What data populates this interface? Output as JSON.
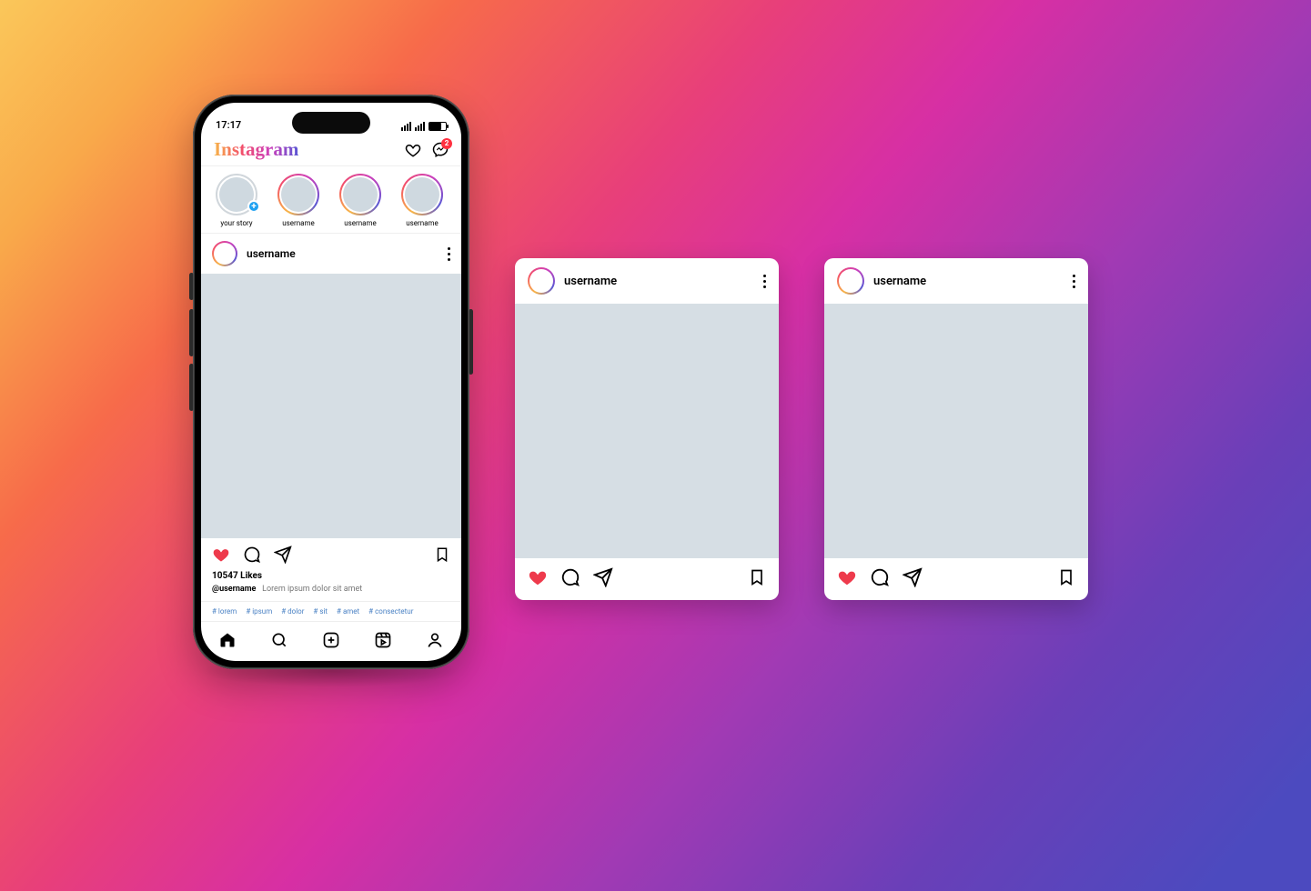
{
  "status": {
    "time": "17:17"
  },
  "header": {
    "logo_text": "Instagram",
    "messages_badge": "2"
  },
  "stories": {
    "items": [
      {
        "label": "your story",
        "own": true
      },
      {
        "label": "username"
      },
      {
        "label": "username"
      },
      {
        "label": "username"
      }
    ]
  },
  "post": {
    "username": "username",
    "likes_text": "10547 Likes",
    "caption_user": "@username",
    "caption_text": "Lorem ipsum dolor sit amet",
    "tags": [
      "# lorem",
      "# ipsum",
      "# dolor",
      "# sit",
      "# amet",
      "# consectetur"
    ]
  },
  "cards": [
    {
      "username": "username"
    },
    {
      "username": "username"
    }
  ]
}
